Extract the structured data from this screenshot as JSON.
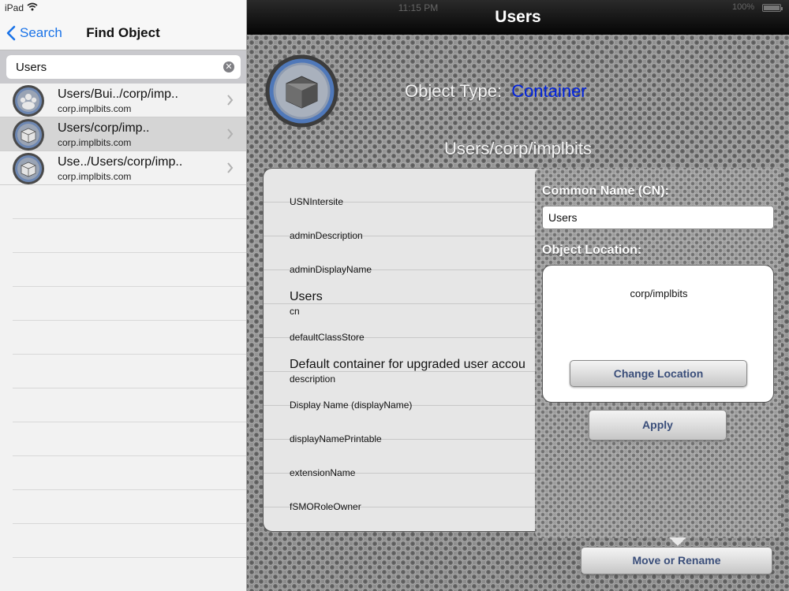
{
  "status_bar": {
    "device": "iPad",
    "time": "11:15 PM",
    "battery": "100%"
  },
  "sidebar": {
    "back_label": "Search",
    "title": "Find Object",
    "search": {
      "value": "Users"
    },
    "results": [
      {
        "title": "Users/Bui../corp/imp..",
        "subtitle": "corp.implbits.com",
        "icon": "user-group-icon",
        "selected": false
      },
      {
        "title": "Users/corp/imp..",
        "subtitle": "corp.implbits.com",
        "icon": "container-icon",
        "selected": true
      },
      {
        "title": "Use../Users/corp/imp..",
        "subtitle": "corp.implbits.com",
        "icon": "container-icon",
        "selected": false
      }
    ]
  },
  "main": {
    "title": "Users",
    "object_type_label": "Object Type:",
    "object_type_value": "Container",
    "object_path": "Users/corp/implbits",
    "attributes": [
      {
        "name": "USNIntersite",
        "value": ""
      },
      {
        "name": "adminDescription",
        "value": ""
      },
      {
        "name": "adminDisplayName",
        "value": ""
      },
      {
        "name": "cn",
        "value": "Users"
      },
      {
        "name": "defaultClassStore",
        "value": ""
      },
      {
        "name": "description",
        "value": "Default container for upgraded user accou"
      },
      {
        "name": "Display Name (displayName)",
        "value": ""
      },
      {
        "name": "displayNamePrintable",
        "value": ""
      },
      {
        "name": "extensionName",
        "value": ""
      },
      {
        "name": "fSMORoleOwner",
        "value": ""
      }
    ]
  },
  "edit_panel": {
    "cn_label": "Common Name (CN):",
    "cn_value": "Users",
    "location_label": "Object Location:",
    "location_value": "corp/implbits",
    "change_location_label": "Change Location",
    "apply_label": "Apply",
    "move_rename_label": "Move or Rename"
  },
  "colors": {
    "accent_blue": "#1a73e8",
    "object_type_value": "#0022dd",
    "button_text": "#3a4e7a"
  }
}
